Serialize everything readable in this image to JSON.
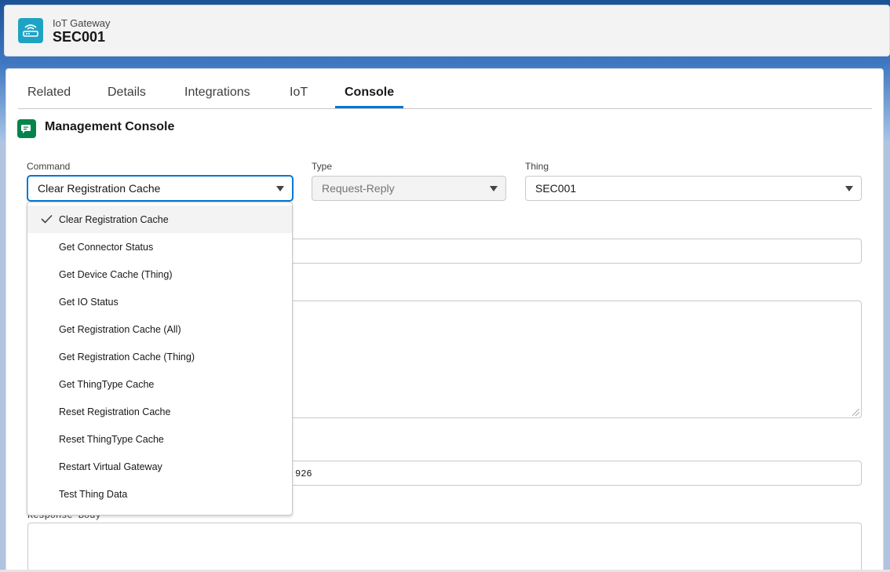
{
  "header": {
    "object_type": "IoT Gateway",
    "record_name": "SEC001",
    "icon": "router-icon"
  },
  "tabs": [
    {
      "label": "Related"
    },
    {
      "label": "Details"
    },
    {
      "label": "Integrations"
    },
    {
      "label": "IoT"
    },
    {
      "label": "Console",
      "active": true
    }
  ],
  "console": {
    "title": "Management Console",
    "icon": "console-chat-icon"
  },
  "fields": {
    "command": {
      "label": "Command",
      "value": "Clear Registration Cache"
    },
    "type": {
      "label": "Type",
      "value": "Request-Reply"
    },
    "thing": {
      "label": "Thing",
      "value": "SEC001"
    },
    "partial_value": "926",
    "response_body_label": "Response Body"
  },
  "dropdown": {
    "options": [
      "Clear Registration Cache",
      "Get Connector Status",
      "Get Device Cache (Thing)",
      "Get IO Status",
      "Get Registration Cache (All)",
      "Get Registration Cache (Thing)",
      "Get ThingType Cache",
      "Reset Registration Cache",
      "Reset ThingType Cache",
      "Restart Virtual Gateway",
      "Test Thing Data"
    ],
    "selected_index": 0
  },
  "colors": {
    "accent": "#0176d3",
    "header_icon_bg": "#1fa3c4",
    "console_icon_bg": "#04844b"
  }
}
